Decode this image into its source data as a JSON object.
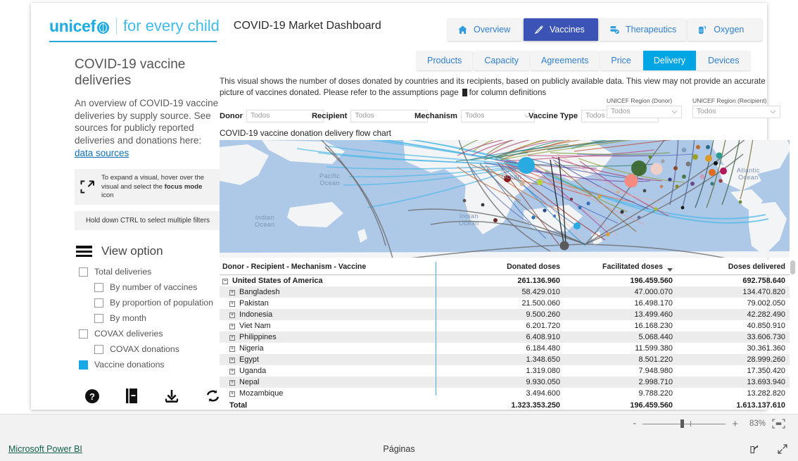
{
  "header": {
    "brand_word": "unicef",
    "brand_tagline": "for every child",
    "dashboard_title": "COVID-19 Market Dashboard"
  },
  "nav_tabs": [
    {
      "label": "Overview",
      "icon": "home-icon",
      "active": false
    },
    {
      "label": "Vaccines",
      "icon": "syringe-icon",
      "active": true
    },
    {
      "label": "Therapeutics",
      "icon": "pills-icon",
      "active": false
    },
    {
      "label": "Oxygen",
      "icon": "oxygen-cylinder-icon",
      "active": false
    }
  ],
  "sub_tabs": [
    {
      "label": "Products",
      "active": false
    },
    {
      "label": "Capacity",
      "active": false
    },
    {
      "label": "Agreements",
      "active": false
    },
    {
      "label": "Price",
      "active": false
    },
    {
      "label": "Delivery",
      "active": true
    },
    {
      "label": "Devices",
      "active": false
    }
  ],
  "sidebar": {
    "title": "COVID-19 vaccine deliveries",
    "description_before": "An overview of COVID-19 vaccine deliveries by supply source. See sources for publicly reported deliveries and donations here: ",
    "description_link": "data sources",
    "hint_focus_a": "To expand a visual, hover over the visual and select the ",
    "hint_focus_bold": "focus mode",
    "hint_focus_b": " icon",
    "hint_ctrl": "Hold down CTRL to select multiple filters",
    "view_option_title": "View option",
    "options": [
      {
        "label": "Total deliveries",
        "checked": false,
        "indent": 0
      },
      {
        "label": "By number of vaccines",
        "checked": false,
        "indent": 1
      },
      {
        "label": "By proportion of population",
        "checked": false,
        "indent": 1
      },
      {
        "label": "By month",
        "checked": false,
        "indent": 1
      },
      {
        "label": "COVAX deliveries",
        "checked": false,
        "indent": 0
      },
      {
        "label": "COVAX donations",
        "checked": false,
        "indent": 1
      },
      {
        "label": "Vaccine donations",
        "checked": true,
        "indent": 0
      }
    ],
    "icons": [
      "help-icon",
      "book-icon",
      "download-icon",
      "refresh-icon"
    ]
  },
  "main": {
    "description": "This visual shows the number of doses donated by countries and its recipients, based on publicly available data. This view may not provide an accurate picture of vaccines donated. Please refer to the assumptions page",
    "description_tail": "for column definitions",
    "viz_title": "COVID-19 vaccine donation delivery flow chart",
    "filters": [
      {
        "label": "Donor",
        "value": "Todos",
        "layout": "inline"
      },
      {
        "label": "Recipient",
        "value": "Todos",
        "layout": "inline"
      },
      {
        "label": "Mechanism",
        "value": "Todos",
        "layout": "inline"
      },
      {
        "label": "Vaccine Type",
        "value": "Todos",
        "layout": "inline"
      },
      {
        "label": "UNICEF Region (Donor)",
        "value": "Todos",
        "layout": "stacked"
      },
      {
        "label": "UNICEF Region (Recipient)",
        "value": "Todos",
        "layout": "stacked"
      }
    ],
    "map_labels": [
      {
        "text": "Pacific\nOcean"
      },
      {
        "text": "Indian\nOcean"
      },
      {
        "text": "Pacific\nOcean"
      },
      {
        "text": "Atlantic\nOcean"
      },
      {
        "text": "Indian\nOcean"
      }
    ]
  },
  "table": {
    "columns": [
      "Donor - Recipient - Mechanism - Vaccine",
      "Donated doses",
      "Facilitated doses",
      "Doses delivered"
    ],
    "sorted_column_index": 2,
    "rows": [
      {
        "label": "United States of America",
        "level": 0,
        "expander": "minus",
        "donated": "261.136.960",
        "facilitated": "196.459.560",
        "delivered": "692.758.640"
      },
      {
        "label": "Bangladesh",
        "level": 1,
        "expander": "plus",
        "donated": "58.429.010",
        "facilitated": "47.000.070",
        "delivered": "134.470.820"
      },
      {
        "label": "Pakistan",
        "level": 1,
        "expander": "plus",
        "donated": "21.500.060",
        "facilitated": "16.498.170",
        "delivered": "79.002.050"
      },
      {
        "label": "Indonesia",
        "level": 1,
        "expander": "plus",
        "donated": "9.500.260",
        "facilitated": "13.499.460",
        "delivered": "42.282.490"
      },
      {
        "label": "Viet Nam",
        "level": 1,
        "expander": "plus",
        "donated": "6.201.720",
        "facilitated": "16.168.230",
        "delivered": "40.850.910"
      },
      {
        "label": "Philippines",
        "level": 1,
        "expander": "plus",
        "donated": "6.408.910",
        "facilitated": "5.068.440",
        "delivered": "33.606.730"
      },
      {
        "label": "Nigeria",
        "level": 1,
        "expander": "plus",
        "donated": "6.184.480",
        "facilitated": "11.599.380",
        "delivered": "30.361.360"
      },
      {
        "label": "Egypt",
        "level": 1,
        "expander": "plus",
        "donated": "1.348.650",
        "facilitated": "8.501.220",
        "delivered": "28.999.260"
      },
      {
        "label": "Uganda",
        "level": 1,
        "expander": "plus",
        "donated": "1.319.080",
        "facilitated": "7.948.980",
        "delivered": "17.350.420"
      },
      {
        "label": "Nepal",
        "level": 1,
        "expander": "plus",
        "donated": "9.930.050",
        "facilitated": "2.998.710",
        "delivered": "13.693.940"
      },
      {
        "label": "Mozambique",
        "level": 1,
        "expander": "plus",
        "donated": "3.494.600",
        "facilitated": "9.788.220",
        "delivered": "13.282.820"
      },
      {
        "label": "Total",
        "level": 1,
        "expander": "none",
        "donated": "1.323.353.250",
        "facilitated": "196.459.560",
        "delivered": "1.613.137.610"
      }
    ]
  },
  "zoombar": {
    "minus": "-",
    "plus": "+",
    "percent": "83%",
    "fit_icon": "fit-to-page-icon"
  },
  "footer": {
    "powerbi_label": "Microsoft Power BI",
    "pages_label": "Páginas",
    "icons": [
      "share-icon",
      "fullscreen-icon"
    ]
  },
  "colors": {
    "unicef_blue": "#1CABE2",
    "active_tab_blue": "#3B53B5",
    "active_subtab_blue": "#00A5E3",
    "accent_checkbox": "#17A9E6",
    "ocean": "#aec9e8",
    "land": "#f2f4f5"
  }
}
